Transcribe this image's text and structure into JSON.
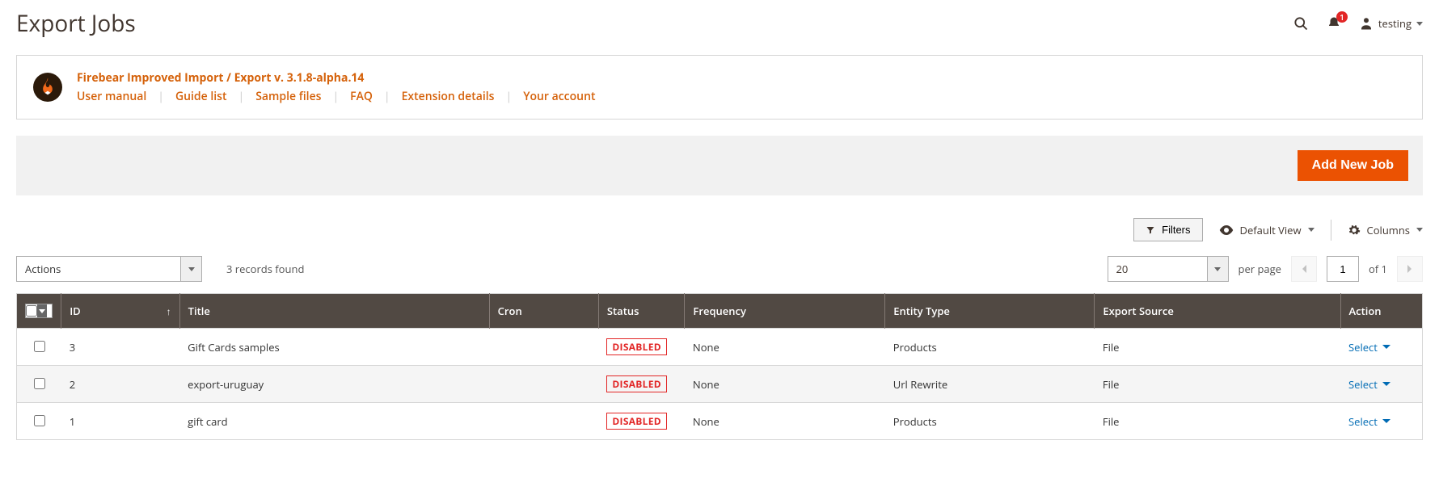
{
  "header": {
    "title": "Export Jobs",
    "notifications": "1",
    "username": "testing"
  },
  "infoBox": {
    "title": "Firebear Improved Import / Export v. 3.1.8-alpha.14",
    "links": [
      "User manual",
      "Guide list",
      "Sample files",
      "FAQ",
      "Extension details",
      "Your account"
    ]
  },
  "actionBar": {
    "addNewLabel": "Add New Job"
  },
  "toolbar": {
    "filtersLabel": "Filters",
    "defaultViewLabel": "Default View",
    "columnsLabel": "Columns",
    "actionsLabel": "Actions",
    "recordsFound": "3 records found",
    "perPageValue": "20",
    "perPageLabel": "per page",
    "pageCurrent": "1",
    "pageOf": "of 1"
  },
  "table": {
    "headers": {
      "id": "ID",
      "title": "Title",
      "cron": "Cron",
      "status": "Status",
      "frequency": "Frequency",
      "entity": "Entity Type",
      "source": "Export Source",
      "action": "Action"
    },
    "rows": [
      {
        "id": "3",
        "title": "Gift Cards samples",
        "cron": "",
        "status": "DISABLED",
        "frequency": "None",
        "entity": "Products",
        "source": "File",
        "action": "Select"
      },
      {
        "id": "2",
        "title": "export-uruguay",
        "cron": "",
        "status": "DISABLED",
        "frequency": "None",
        "entity": "Url Rewrite",
        "source": "File",
        "action": "Select"
      },
      {
        "id": "1",
        "title": "gift card",
        "cron": "",
        "status": "DISABLED",
        "frequency": "None",
        "entity": "Products",
        "source": "File",
        "action": "Select"
      }
    ]
  }
}
